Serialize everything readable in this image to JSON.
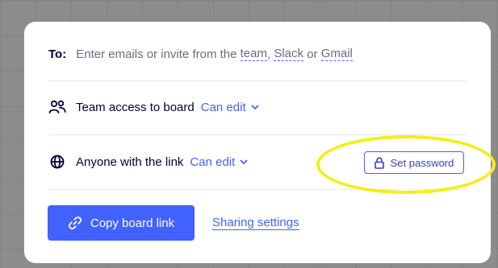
{
  "share": {
    "to_label": "To:",
    "to_prefix": "Enter emails or invite from the",
    "team_link": "team",
    "comma": ",",
    "slack_link": "Slack",
    "or_word": "or",
    "gmail_link": "Gmail",
    "team_access_label": "Team access to board",
    "team_access_value": "Can edit",
    "link_access_label": "Anyone with the link",
    "link_access_value": "Can edit",
    "set_password_label": "Set password",
    "copy_link_label": "Copy board link",
    "sharing_settings_label": "Sharing settings"
  },
  "colors": {
    "accent": "#4262ff",
    "text": "#050038",
    "muted": "#6b6b80",
    "annotation": "#f5ee17"
  },
  "icons": {
    "team": "team-users-icon",
    "globe": "globe-icon",
    "chevron": "chevron-down-icon",
    "lock": "lock-icon",
    "link": "link-icon"
  }
}
